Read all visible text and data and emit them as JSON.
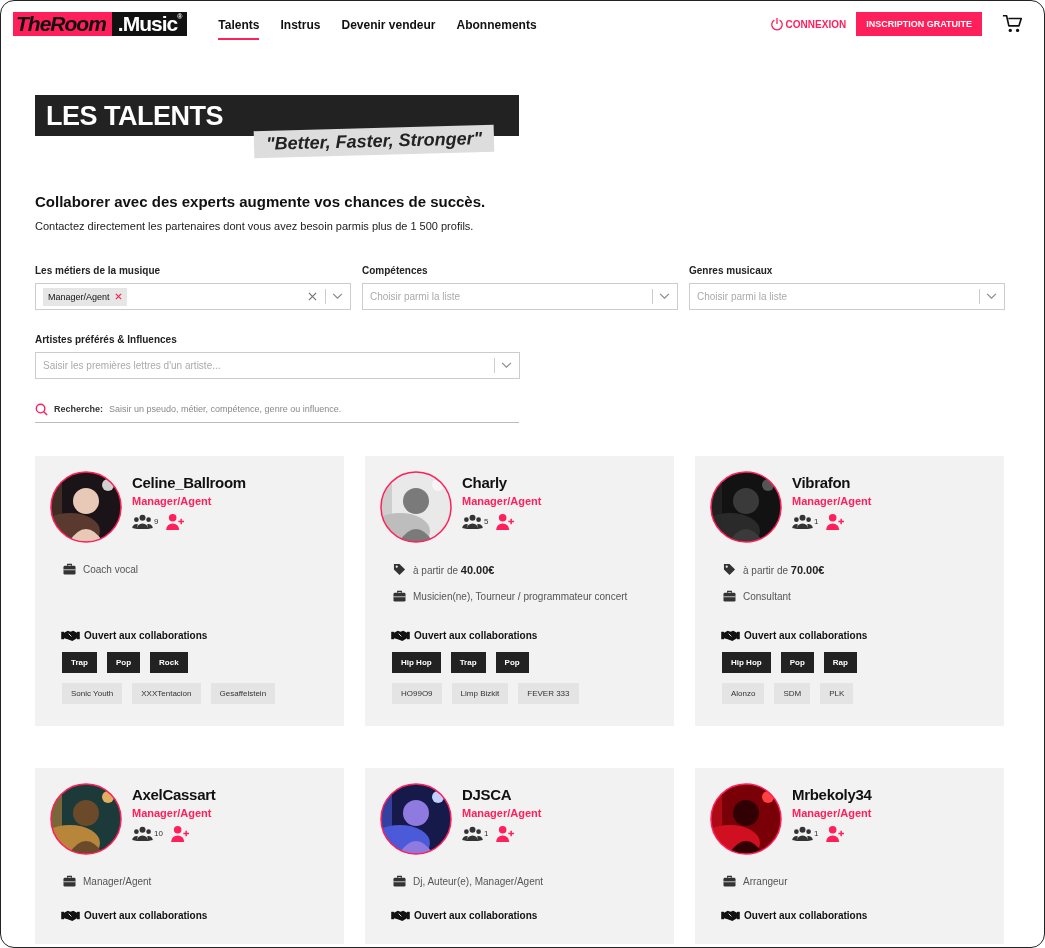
{
  "header": {
    "logo": {
      "brand": "TheRoom",
      "suffix": ".Music",
      "mark": "®"
    },
    "nav": [
      {
        "label": "Talents",
        "selected": true
      },
      {
        "label": "Instrus",
        "selected": false
      },
      {
        "label": "Devenir vendeur",
        "selected": false
      },
      {
        "label": "Abonnements",
        "selected": false
      }
    ],
    "login": "CONNEXION",
    "signup": "INSCRIPTION GRATUITE"
  },
  "hero": {
    "title": "LES TALENTS",
    "tagline": "\"Better, Faster, Stronger\""
  },
  "intro": {
    "heading": "Collaborer avec des experts augmente vos chances de succès.",
    "text": "Contactez directement les partenaires dont vous avez besoin parmis plus de 1 500 profils."
  },
  "filters": [
    {
      "label": "Les métiers de la musique",
      "chips": [
        "Manager/Agent"
      ]
    },
    {
      "label": "Compétences",
      "placeholder": "Choisir parmi la liste"
    },
    {
      "label": "Genres musicaux",
      "placeholder": "Choisir parmi la liste"
    },
    {
      "label": "Artistes préférés & Influences",
      "placeholder": "Saisir les premières lettres d'un artiste..."
    }
  ],
  "search": {
    "label": "Recherche:",
    "placeholder": "Saisir un pseudo, métier, compétence, genre ou influence."
  },
  "talents": [
    {
      "name": "Celine_Ballroom",
      "role": "Manager/Agent",
      "followers": "9",
      "job": "Coach vocal",
      "collab": "Ouvert aux collaborations",
      "genres": [
        "Trap",
        "Pop",
        "Rock"
      ],
      "artists": [
        "Sonic Youth",
        "XXXTentacion",
        "Gesaffelstein"
      ]
    },
    {
      "name": "Charly",
      "role": "Manager/Agent",
      "followers": "5",
      "price": "à partir de **40.00€**",
      "job": "Musicien(ne), Tourneur / programmateur concert",
      "collab": "Ouvert aux collaborations",
      "genres": [
        "Hip Hop",
        "Trap",
        "Pop"
      ],
      "artists": [
        "HO99O9",
        "Limp Bizkit",
        "FEVER 333"
      ]
    },
    {
      "name": "Vibrafon",
      "role": "Manager/Agent",
      "followers": "1",
      "price": "à partir de **70.00€**",
      "job": "Consultant",
      "collab": "Ouvert aux collaborations",
      "genres": [
        "Hip Hop",
        "Pop",
        "Rap"
      ],
      "artists": [
        "Alonzo",
        "SDM",
        "PLK"
      ]
    },
    {
      "name": "AxelCassart",
      "role": "Manager/Agent",
      "followers": "10",
      "job": "Manager/Agent",
      "collab": "Ouvert aux collaborations"
    },
    {
      "name": "DJSCA",
      "role": "Manager/Agent",
      "followers": "1",
      "job": "Dj, Auteur(e), Manager/Agent",
      "collab": "Ouvert aux collaborations"
    },
    {
      "name": "Mrbekoly34",
      "role": "Manager/Agent",
      "followers": "1",
      "job": "Arrangeur",
      "collab": "Ouvert aux collaborations"
    }
  ]
}
